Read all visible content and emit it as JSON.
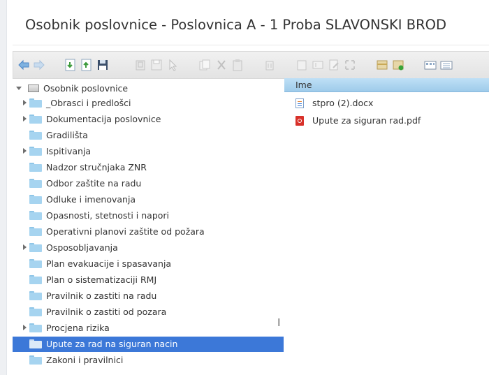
{
  "window": {
    "title": "Osobnik poslovnice - Poslovnica A - 1 Proba SLAVONSKI BROD"
  },
  "toolbar": {
    "buttons": [
      {
        "name": "back-arrow-icon",
        "enabled": true
      },
      {
        "name": "forward-arrow-icon",
        "enabled": false
      },
      {
        "name": "download-icon",
        "enabled": true
      },
      {
        "name": "upload-icon",
        "enabled": true
      },
      {
        "name": "save-icon",
        "enabled": true
      },
      {
        "name": "folder-icon",
        "enabled": false
      },
      {
        "name": "save-disabled-icon",
        "enabled": false
      },
      {
        "name": "pointer-icon",
        "enabled": false
      },
      {
        "name": "copy-icon",
        "enabled": false
      },
      {
        "name": "cut-icon",
        "enabled": false
      },
      {
        "name": "paste-icon",
        "enabled": false
      },
      {
        "name": "delete-icon",
        "enabled": false
      },
      {
        "name": "duplicate-icon",
        "enabled": false
      },
      {
        "name": "rename-icon",
        "enabled": false
      },
      {
        "name": "edit-icon",
        "enabled": false
      },
      {
        "name": "fullscreen-icon",
        "enabled": false
      },
      {
        "name": "extract-icon",
        "enabled": true
      },
      {
        "name": "archive-icon",
        "enabled": true
      },
      {
        "name": "view-icons-icon",
        "enabled": true
      },
      {
        "name": "view-list-icon",
        "enabled": true
      }
    ]
  },
  "tree": {
    "root": "Osobnik poslovnice",
    "items": [
      {
        "label": "_Obrasci i predlošci",
        "expandable": true
      },
      {
        "label": "Dokumentacija poslovnice",
        "expandable": true
      },
      {
        "label": "Gradilišta",
        "expandable": false
      },
      {
        "label": "Ispitivanja",
        "expandable": true
      },
      {
        "label": "Nadzor stručnjaka ZNR",
        "expandable": false
      },
      {
        "label": "Odbor zaštite na radu",
        "expandable": false
      },
      {
        "label": "Odluke i imenovanja",
        "expandable": false
      },
      {
        "label": "Opasnosti, stetnosti i napori",
        "expandable": false
      },
      {
        "label": "Operativni planovi zaštite od požara",
        "expandable": false
      },
      {
        "label": "Osposobljavanja",
        "expandable": true
      },
      {
        "label": "Plan evakuacije i spasavanja",
        "expandable": false
      },
      {
        "label": "Plan o sistematizaciji RMJ",
        "expandable": false
      },
      {
        "label": "Pravilnik o zastiti na radu",
        "expandable": false
      },
      {
        "label": "Pravilnik o zastiti od pozara",
        "expandable": false
      },
      {
        "label": "Procjena rizika",
        "expandable": true
      },
      {
        "label": "Upute za rad na siguran nacin",
        "expandable": false,
        "selected": true
      },
      {
        "label": "Zakoni i pravilnici",
        "expandable": false
      }
    ]
  },
  "files": {
    "column_header": "Ime",
    "items": [
      {
        "label": "stpro (2).docx",
        "icon": "docx-file-icon"
      },
      {
        "label": "Upute za siguran rad.pdf",
        "icon": "pdf-file-icon"
      }
    ]
  },
  "colors": {
    "selection": "#3c78d8",
    "header": "#b3d7f2",
    "folder": "#a6d4f0"
  }
}
